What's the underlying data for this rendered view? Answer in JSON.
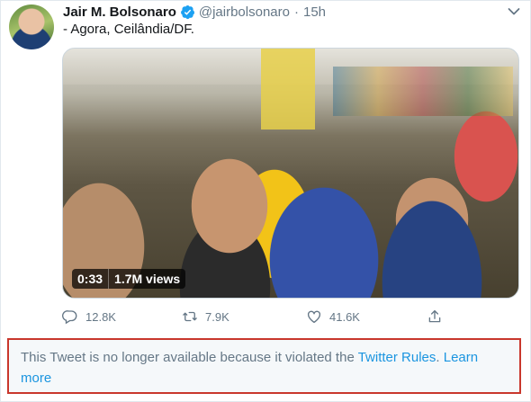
{
  "tweet": {
    "author_name": "Jair M. Bolsonaro",
    "handle": "@jairbolsonaro",
    "separator": "·",
    "time": "15h",
    "text": "- Agora, Ceilândia/DF.",
    "verified": true
  },
  "media": {
    "duration": "0:33",
    "views": "1.7M views"
  },
  "actions": {
    "replies": "12.8K",
    "retweets": "7.9K",
    "likes": "41.6K"
  },
  "notice": {
    "text": "This Tweet is no longer available because it violated the ",
    "rules_link": "Twitter Rules",
    "period": ". ",
    "learn_more": "Learn more"
  },
  "colors": {
    "accent": "#1da1f2",
    "link": "#1b95e0",
    "muted": "#657786",
    "notice_border": "#c9372c"
  },
  "icons": [
    "verified-badge-icon",
    "caret-down-icon",
    "reply-icon",
    "retweet-icon",
    "like-icon",
    "share-icon"
  ]
}
